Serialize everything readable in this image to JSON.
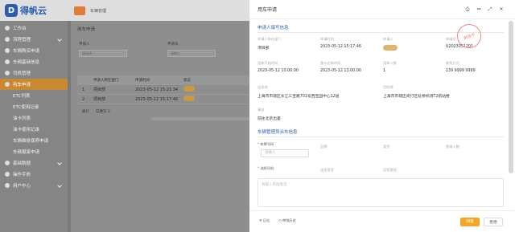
{
  "app": {
    "logo_mark": "D",
    "logo_text": "得帆云",
    "module_title": "车辆管理"
  },
  "sidebar": {
    "items": [
      {
        "label": "工作台",
        "sub": false,
        "active": false
      },
      {
        "label": "流程管理",
        "sub": false,
        "active": false
      },
      {
        "label": "车辆购买申请",
        "sub": false,
        "active": false
      },
      {
        "label": "车辆基础信息",
        "sub": false,
        "active": false
      },
      {
        "label": "司机管理",
        "sub": false,
        "active": false
      },
      {
        "label": "用车申请",
        "sub": false,
        "active": true
      },
      {
        "label": "ETC列表",
        "sub": true,
        "active": false
      },
      {
        "label": "ETC使用记录",
        "sub": true,
        "active": false
      },
      {
        "label": "油卡列表",
        "sub": true,
        "active": false
      },
      {
        "label": "油卡使用记录",
        "sub": true,
        "active": false
      },
      {
        "label": "车辆维修保养申请",
        "sub": true,
        "active": false
      },
      {
        "label": "车辆报废申请",
        "sub": true,
        "active": false
      },
      {
        "label": "基础数据",
        "sub": false,
        "active": false
      },
      {
        "label": "操作手册",
        "sub": false,
        "active": false
      },
      {
        "label": "用户中心",
        "sub": false,
        "active": false
      }
    ]
  },
  "main": {
    "title": "用车申请",
    "filters": [
      {
        "label": "申请人",
        "placeholder": "请选择"
      },
      {
        "label": "申请号",
        "placeholder": "请输入"
      }
    ],
    "table": {
      "headers": [
        "",
        "申请人所在部门",
        "申请时间",
        "状态"
      ],
      "rows": [
        {
          "idx": "1",
          "dept": "项目部",
          "time": "2023-05-12 15:21:34"
        },
        {
          "idx": "2",
          "dept": "项目部",
          "time": "2023-05-12 15:17:46"
        }
      ],
      "footer_total": "统计",
      "footer_status": "已填写 2"
    }
  },
  "drawer": {
    "title": "用车申请",
    "icons": [
      "print-icon",
      "expand-icon",
      "fullscreen-icon",
      "close-icon"
    ],
    "section1": "申请人填写信息",
    "stamp": "审核中",
    "fields": [
      {
        "label": "申请人所在部门",
        "value": "项目部"
      },
      {
        "label": "申请时间",
        "value": "2023-05-12 15:17:46"
      },
      {
        "label": "申请人",
        "value": ""
      },
      {
        "label": "申请号",
        "value": "U2023051201"
      },
      {
        "label": "用车开始时间",
        "value": "2023-05-12 10:00:00"
      },
      {
        "label": "预计还车时间",
        "value": "2023-05-12 13:00:00"
      },
      {
        "label": "用车人数",
        "value": "1"
      },
      {
        "label": "联系方式",
        "value": "139 9999 9999"
      },
      {
        "label": "出发地",
        "value": "上海市市辖区长江三宝路701号西宝园中心12层"
      },
      {
        "label": "目的地",
        "value": "上海市市辖区闵行区虹桥机场T2航站楼"
      },
      {
        "label": "事由",
        "value": "前往北京出差"
      }
    ],
    "section2": "车辆管理员派车信息",
    "plate_label": "车牌号码",
    "plate_placeholder": "请输入",
    "brand_label": "品牌",
    "model_label": "类型",
    "seats_label": "限乘人数",
    "driver_label": "选择司机",
    "km_label": "出发里程",
    "back_km_label": "回程里程",
    "remark_placeholder": "请输入审批意见",
    "footer": {
      "log": "日志",
      "history": "审批历史",
      "submit": "同意",
      "reject": "拒绝"
    }
  },
  "colors": {
    "accent": "#2a5db0",
    "active": "#c78a32",
    "submit": "#f5a623"
  }
}
